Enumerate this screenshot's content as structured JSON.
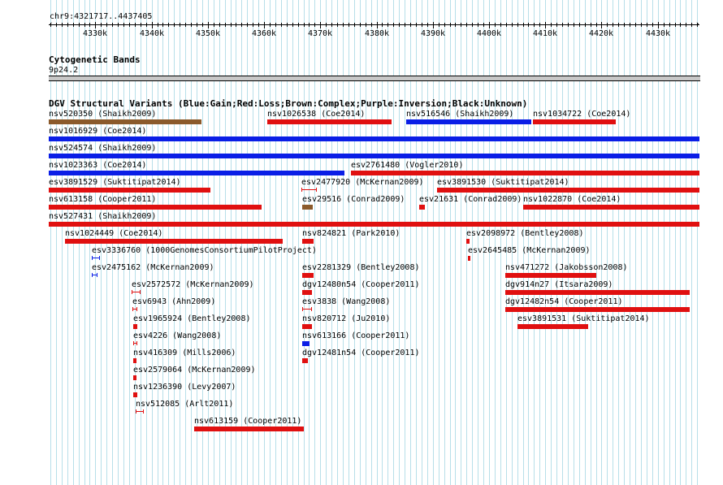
{
  "colors": {
    "gain": "#0a1ee6",
    "loss": "#e01010",
    "complex": "#8b5a2b",
    "grid": "#b7dfe9"
  },
  "ruler": {
    "region": "chr9:4321717..4437405",
    "ticks": [
      "4330k",
      "4340k",
      "4350k",
      "4360k",
      "4370k",
      "4380k",
      "4390k",
      "4400k",
      "4410k",
      "4420k",
      "4430k"
    ]
  },
  "cytoband": {
    "title": "Cytogenetic Bands",
    "band": "9p24.2"
  },
  "dgv": {
    "title": "DGV Structural Variants (Blue:Gain;Red:Loss;Brown:Complex;Purple:Inversion;Black:Unknown)",
    "features": [
      {
        "label": "nsv520350 (Shaikh2009)",
        "color": "complex",
        "start": 4321717,
        "end": 4348800,
        "row": 0
      },
      {
        "label": "nsv1026538 (Coe2014)",
        "color": "loss",
        "start": 4360600,
        "end": 4382700,
        "row": 0
      },
      {
        "label": "nsv516546 (Shaikh2009)",
        "color": "gain",
        "start": 4385300,
        "end": 4407500,
        "row": 0
      },
      {
        "label": "nsv1034722 (Coe2014)",
        "color": "loss",
        "start": 4407800,
        "end": 4422500,
        "row": 0
      },
      {
        "label": "nsv1016929 (Coe2014)",
        "color": "gain",
        "start": 4321717,
        "end": 4437405,
        "row": 1
      },
      {
        "label": "nsv524574 (Shaikh2009)",
        "color": "gain",
        "start": 4321717,
        "end": 4437405,
        "row": 2
      },
      {
        "label": "nsv1023363 (Coe2014)",
        "color": "gain",
        "start": 4321717,
        "end": 4374300,
        "row": 3
      },
      {
        "label": "esv2761480 (Vogler2010)",
        "color": "loss",
        "start": 4375400,
        "end": 4437405,
        "row": 3
      },
      {
        "label": "esv3891529 (Suktitipat2014)",
        "color": "loss",
        "start": 4321717,
        "end": 4350500,
        "row": 4
      },
      {
        "label": "esv2477920 (McKernan2009)",
        "color": "loss",
        "start": 4366600,
        "end": 4369400,
        "row": 4,
        "style": "h"
      },
      {
        "label": "esv3891530 (Suktitipat2014)",
        "color": "loss",
        "start": 4390700,
        "end": 4437405,
        "row": 4
      },
      {
        "label": "nsv613158 (Cooper2011)",
        "color": "loss",
        "start": 4321717,
        "end": 4359500,
        "row": 5
      },
      {
        "label": "esv29516 (Conrad2009)",
        "color": "complex",
        "start": 4366800,
        "end": 4368700,
        "row": 5
      },
      {
        "label": "esv21631 (Conrad2009)",
        "color": "loss",
        "start": 4387600,
        "end": 4388600,
        "row": 5
      },
      {
        "label": "nsv1022870 (Coe2014)",
        "color": "loss",
        "start": 4406000,
        "end": 4437405,
        "row": 5
      },
      {
        "label": "nsv527431 (Shaikh2009)",
        "color": "loss",
        "start": 4321717,
        "end": 4437405,
        "row": 6
      },
      {
        "label": "nsv1024449 (Coe2014)",
        "color": "loss",
        "start": 4324600,
        "end": 4363300,
        "row": 7
      },
      {
        "label": "nsv824821 (Park2010)",
        "color": "loss",
        "start": 4366800,
        "end": 4368800,
        "row": 7
      },
      {
        "label": "esv2098972 (Bentley2008)",
        "color": "loss",
        "start": 4396000,
        "end": 4396600,
        "row": 7
      },
      {
        "label": "esv3336760 (1000GenomesConsortiumPilotProject)",
        "color": "gain",
        "start": 4329300,
        "end": 4330800,
        "row": 8,
        "style": "h"
      },
      {
        "label": "esv2645485 (McKernan2009)",
        "color": "loss",
        "start": 4396200,
        "end": 4396500,
        "row": 8
      },
      {
        "label": "esv2475162 (McKernan2009)",
        "color": "gain",
        "start": 4329400,
        "end": 4330400,
        "row": 9,
        "style": "h"
      },
      {
        "label": "esv2281329 (Bentley2008)",
        "color": "loss",
        "start": 4366800,
        "end": 4368800,
        "row": 9
      },
      {
        "label": "nsv471272 (Jakobsson2008)",
        "color": "loss",
        "start": 4402900,
        "end": 4419000,
        "row": 9
      },
      {
        "label": "esv2572572 (McKernan2009)",
        "color": "loss",
        "start": 4336500,
        "end": 4338100,
        "row": 10,
        "style": "h"
      },
      {
        "label": "dgv12480n54 (Cooper2011)",
        "color": "loss",
        "start": 4366800,
        "end": 4368500,
        "row": 10
      },
      {
        "label": "dgv914n27 (Itsara2009)",
        "color": "loss",
        "start": 4402900,
        "end": 4435600,
        "row": 10
      },
      {
        "label": "esv6943 (Ahn2009)",
        "color": "loss",
        "start": 4336600,
        "end": 4337400,
        "row": 11,
        "style": "h"
      },
      {
        "label": "esv3838 (Wang2008)",
        "color": "loss",
        "start": 4366800,
        "end": 4368500,
        "row": 11,
        "style": "h"
      },
      {
        "label": "dgv12482n54 (Cooper2011)",
        "color": "loss",
        "start": 4402900,
        "end": 4435600,
        "row": 11
      },
      {
        "label": "esv1965924 (Bentley2008)",
        "color": "loss",
        "start": 4336700,
        "end": 4337400,
        "row": 12
      },
      {
        "label": "nsv820712 (Ju2010)",
        "color": "loss",
        "start": 4366800,
        "end": 4368500,
        "row": 12
      },
      {
        "label": "esv3891531 (Suktitipat2014)",
        "color": "loss",
        "start": 4405000,
        "end": 4417600,
        "row": 12
      },
      {
        "label": "esv4226 (Wang2008)",
        "color": "loss",
        "start": 4336700,
        "end": 4337400,
        "row": 13,
        "style": "h"
      },
      {
        "label": "nsv613166 (Cooper2011)",
        "color": "gain",
        "start": 4366800,
        "end": 4368100,
        "row": 13
      },
      {
        "label": "nsv416309 (Mills2006)",
        "color": "loss",
        "start": 4336800,
        "end": 4337300,
        "row": 14
      },
      {
        "label": "dgv12481n54 (Cooper2011)",
        "color": "loss",
        "start": 4366800,
        "end": 4367800,
        "row": 14
      },
      {
        "label": "esv2579064 (McKernan2009)",
        "color": "loss",
        "start": 4336800,
        "end": 4337300,
        "row": 15
      },
      {
        "label": "nsv1236390 (Levy2007)",
        "color": "loss",
        "start": 4336800,
        "end": 4337400,
        "row": 16
      },
      {
        "label": "nsv512085 (Arlt2011)",
        "color": "loss",
        "start": 4337200,
        "end": 4338600,
        "row": 17,
        "style": "h"
      },
      {
        "label": "nsv613159 (Cooper2011)",
        "color": "loss",
        "start": 4347600,
        "end": 4367100,
        "row": 18
      }
    ]
  }
}
